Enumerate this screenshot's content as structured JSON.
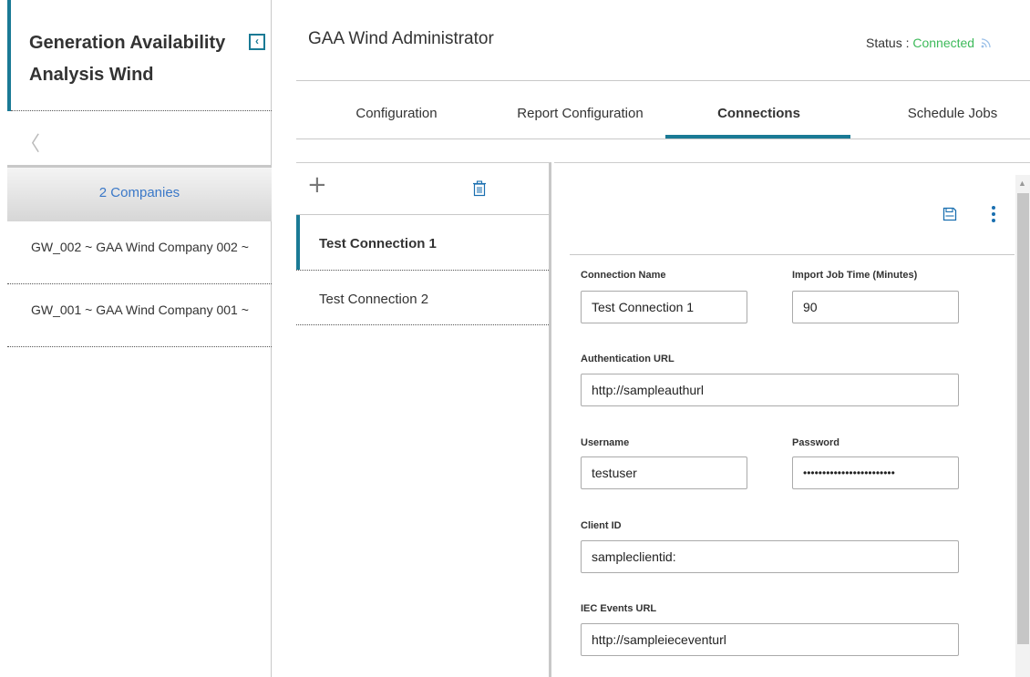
{
  "sidebar": {
    "app_title": "Generation Availability Analysis Wind",
    "collapse_glyph": "‹",
    "back_glyph": "〈",
    "companies_header": "2 Companies",
    "companies": [
      {
        "label": "GW_002 ~ GAA Wind Company 002 ~"
      },
      {
        "label": "GW_001 ~ GAA Wind Company 001 ~"
      }
    ]
  },
  "header": {
    "title": "GAA Wind Administrator",
    "status_label": "Status :",
    "status_value": "Connected",
    "status_color": "#3dba5a"
  },
  "tabs": [
    {
      "label": "Configuration"
    },
    {
      "label": "Report Configuration"
    },
    {
      "label": "Connections"
    },
    {
      "label": "Schedule Jobs"
    }
  ],
  "connections": {
    "add_glyph": "+",
    "items": [
      {
        "label": "Test Connection 1"
      },
      {
        "label": "Test Connection 2"
      }
    ]
  },
  "form": {
    "connection_name_label": "Connection Name",
    "connection_name_value": "Test Connection 1",
    "import_job_time_label": "Import Job Time (Minutes)",
    "import_job_time_value": "90",
    "auth_url_label": "Authentication URL",
    "auth_url_value": "http://sampleauthurl",
    "username_label": "Username",
    "username_value": "testuser",
    "password_label": "Password",
    "password_value": "••••••••••••••••••••••••",
    "client_id_label": "Client ID",
    "client_id_value": "sampleclientid:",
    "iec_events_url_label": "IEC Events URL",
    "iec_events_url_value": "http://sampleieceventurl"
  },
  "colors": {
    "accent": "#1a7a95",
    "link_blue": "#3a78c8",
    "icon_blue": "#1a6fb0"
  },
  "icons": [
    "collapse-icon",
    "back-chevron-icon",
    "plus-icon",
    "trash-icon",
    "save-icon",
    "more-vertical-icon",
    "signal-icon",
    "scroll-up-icon"
  ]
}
